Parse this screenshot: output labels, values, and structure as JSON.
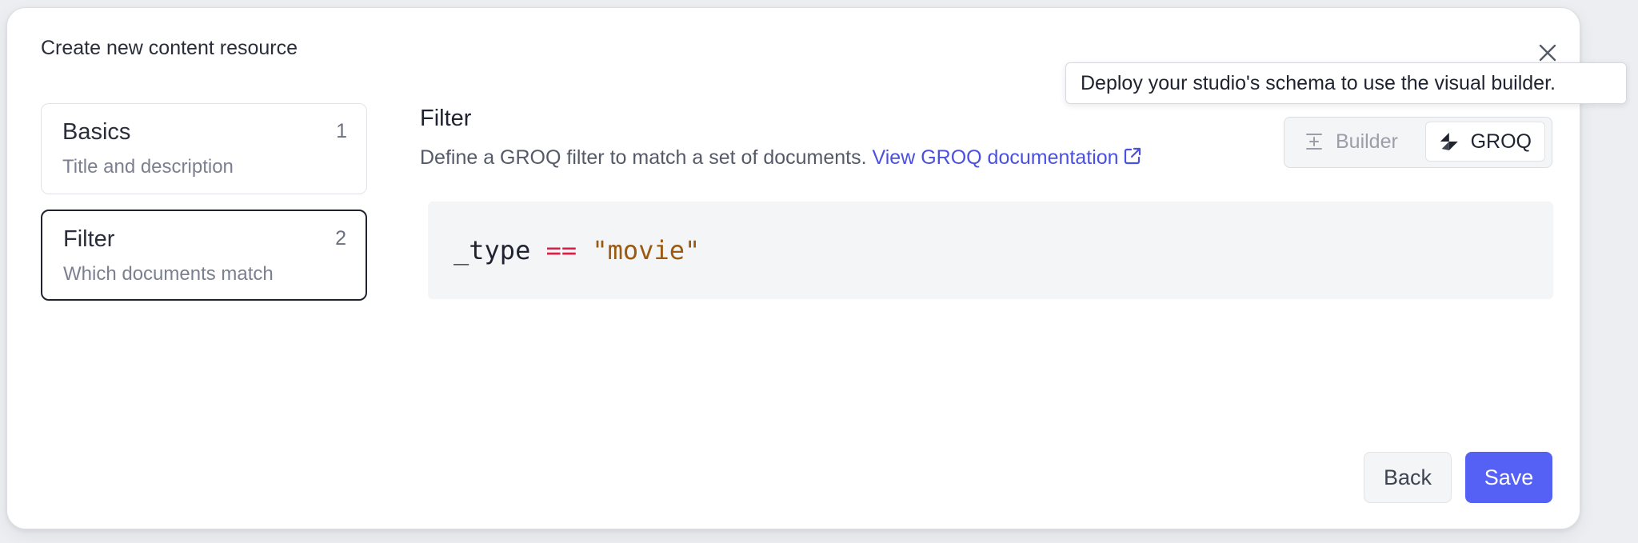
{
  "dialog": {
    "title": "Create new content resource"
  },
  "steps": [
    {
      "title": "Basics",
      "number": "1",
      "subtitle": "Title and description",
      "active": false
    },
    {
      "title": "Filter",
      "number": "2",
      "subtitle": "Which documents match",
      "active": true
    }
  ],
  "section": {
    "title": "Filter",
    "description": "Define a GROQ filter to match a set of documents.",
    "link_label": "View GROQ documentation"
  },
  "toggle": {
    "builder_label": "Builder",
    "groq_label": "GROQ",
    "selected": "GROQ"
  },
  "tooltip": {
    "text": "Deploy your studio's schema to use the visual builder."
  },
  "code": {
    "ident": "_type",
    "operator": "==",
    "string": "\"movie\""
  },
  "footer": {
    "back_label": "Back",
    "save_label": "Save"
  },
  "colors": {
    "accent": "#5561f5",
    "link": "#4b50e0",
    "operator": "#d6224a",
    "string": "#9a5a10"
  }
}
